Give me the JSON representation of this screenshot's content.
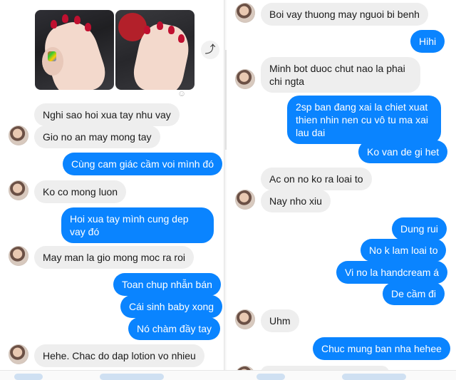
{
  "left": {
    "messages": [
      {
        "text": "Nghi sao hoi xua tay nhu vay"
      },
      {
        "text": "Gio no an may mong tay"
      },
      {
        "text": "Cùng cam giác cầm voi mình đó"
      },
      {
        "text": "Ko co mong luon"
      },
      {
        "text": "Hoi xua tay mình cung dep vay đó"
      },
      {
        "text": "May man la gio mong moc ra roi"
      },
      {
        "text": "Toan chup nhẫn bán"
      },
      {
        "text": "Cái sinh baby xong"
      },
      {
        "text": "Nó chàm đầy tay"
      },
      {
        "text": "Hehe. Chac do dap lotion vo nhieu"
      }
    ]
  },
  "right": {
    "messages": [
      {
        "text": "Boi vay thuong may nguoi bi benh"
      },
      {
        "text": "Hihi"
      },
      {
        "text": "Minh bot duoc chut nao la phai chi ngta"
      },
      {
        "text": "2sp ban đang xai la chiet xuat thien nhin nen cu vô tu ma xai lau dai"
      },
      {
        "text": "Ko van de gi het"
      },
      {
        "text": "Ac on no ko ra loai to"
      },
      {
        "text": "Nay nho xiu"
      },
      {
        "text": "Dung rui"
      },
      {
        "text": "No k lam loai to"
      },
      {
        "text": "Vi no la handcream á"
      },
      {
        "text": "De cầm đi"
      },
      {
        "text": "Uhm"
      },
      {
        "text": "Chuc mung ban nha hehee"
      }
    ]
  },
  "icons": {
    "share": "share-icon",
    "react": "add-reaction-icon",
    "avatar": "contact-avatar"
  },
  "colors": {
    "outgoing_bubble": "#0a84ff",
    "incoming_bubble": "#eeeeee"
  }
}
